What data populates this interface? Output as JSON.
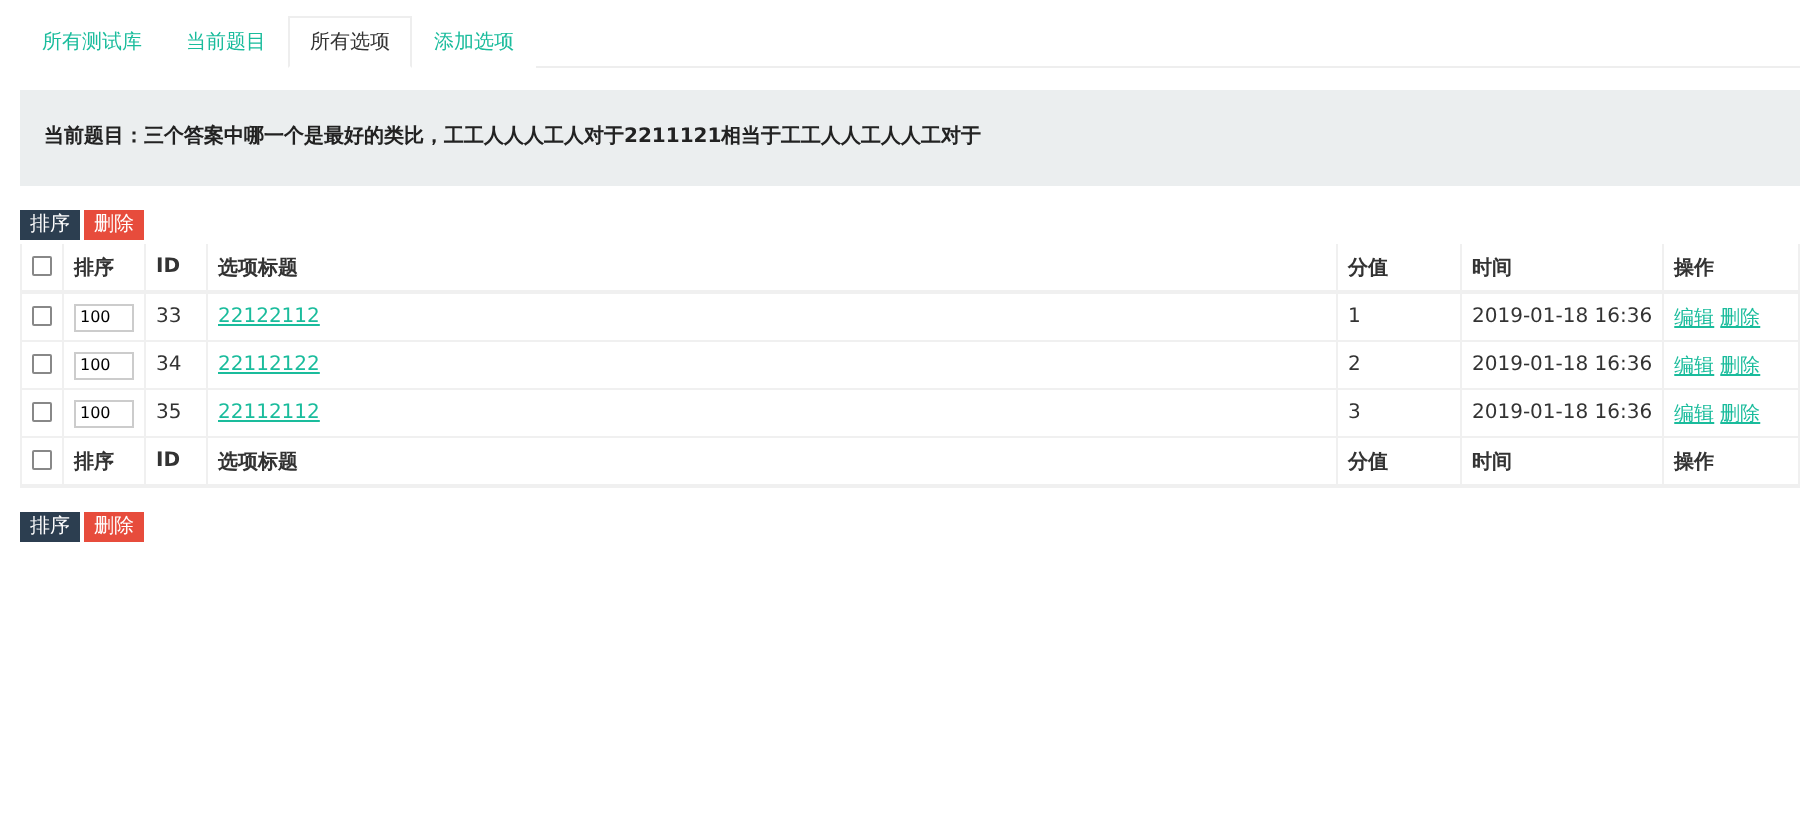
{
  "tabs": [
    {
      "label": "所有测试库",
      "selected": false
    },
    {
      "label": "当前题目",
      "selected": false
    },
    {
      "label": "所有选项",
      "selected": true
    },
    {
      "label": "添加选项",
      "selected": false
    }
  ],
  "question": "当前题目：三个答案中哪一个是最好的类比，工工人人人工人对于2211121相当于工工人人工人人工对于",
  "top_actions": [
    {
      "label": "排序",
      "kind": "sort"
    },
    {
      "label": "删除",
      "kind": "delete"
    }
  ],
  "table": {
    "header_select_all_checked": false,
    "footer_select_all_checked": false,
    "columns": [
      "排序",
      "ID",
      "选项标题",
      "分值",
      "时间",
      "操作"
    ],
    "rows": [
      {
        "checked": false,
        "order": "100",
        "id": "33",
        "title": "22122112",
        "score": "1",
        "time": "2019-01-18 16:36",
        "actions": [
          "编辑",
          "删除"
        ]
      },
      {
        "checked": false,
        "order": "100",
        "id": "34",
        "title": "22112122",
        "score": "2",
        "time": "2019-01-18 16:36",
        "actions": [
          "编辑",
          "删除"
        ]
      },
      {
        "checked": false,
        "order": "100",
        "id": "35",
        "title": "22112112",
        "score": "3",
        "time": "2019-01-18 16:36",
        "actions": [
          "编辑",
          "删除"
        ]
      }
    ],
    "footer_columns": [
      "排序",
      "ID",
      "选项标题",
      "分值",
      "时间",
      "操作"
    ]
  },
  "bottom_actions": [
    {
      "label": "排序",
      "kind": "sort"
    },
    {
      "label": "删除",
      "kind": "delete"
    }
  ]
}
